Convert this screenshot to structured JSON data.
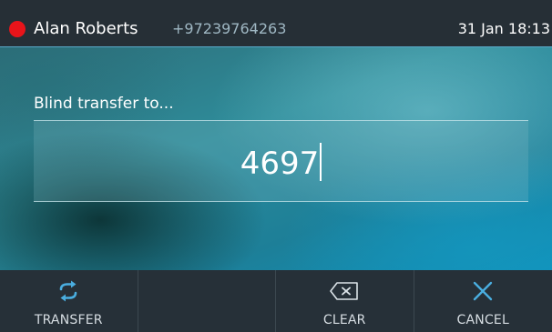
{
  "status_bar": {
    "caller_name": "Alan Roberts",
    "caller_number": "+97239764263",
    "datetime": "31 Jan 18:13",
    "call_indicator_color": "#e8141a"
  },
  "transfer": {
    "prompt": "Blind transfer to...",
    "value": "4697"
  },
  "softkeys": [
    {
      "label": "TRANSFER",
      "icon": "transfer-arrows-icon"
    },
    {
      "label": "",
      "icon": ""
    },
    {
      "label": "CLEAR",
      "icon": "backspace-icon"
    },
    {
      "label": "CANCEL",
      "icon": "close-icon"
    }
  ],
  "colors": {
    "accent": "#4aaee0",
    "statusbar_bg": "#262f36",
    "softkey_bg": "#263038"
  }
}
